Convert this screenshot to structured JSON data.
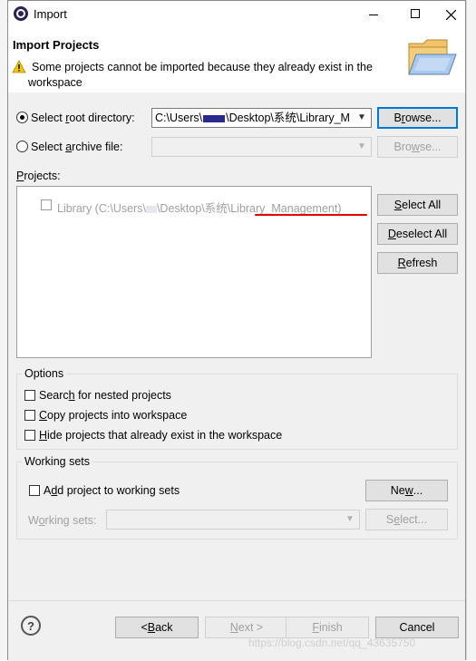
{
  "window": {
    "title": "Import"
  },
  "banner": {
    "title": "Import Projects",
    "message_line1": "Some projects cannot be imported because they already exist in the",
    "message_line2": "workspace"
  },
  "source": {
    "root_label_pre": "Select ",
    "root_label_u": "r",
    "root_label_post": "oot directory:",
    "root_value_pre": "C:\\Users\\",
    "root_value_post": "\\Desktop\\系统\\Library_M",
    "root_browse_pre": "B",
    "root_browse_u": "r",
    "root_browse_post": "owse...",
    "archive_label_pre": "Select ",
    "archive_label_u": "a",
    "archive_label_post": "rchive file:",
    "archive_value": "",
    "archive_browse_pre": "Bro",
    "archive_browse_u": "w",
    "archive_browse_post": "se..."
  },
  "projects": {
    "label_u": "P",
    "label_post": "rojects:",
    "items": [
      {
        "text_pre": "Library (C:\\Users\\",
        "text_post": "\\Desktop\\系统\\",
        "text_mark": "Library_Management)",
        "checked": false
      }
    ],
    "select_all_u": "S",
    "select_all_post": "elect All",
    "deselect_all_u": "D",
    "deselect_all_post": "eselect All",
    "refresh_pre": "R",
    "refresh_post": "efresh"
  },
  "options": {
    "title": "Options",
    "nested_pre": "Searc",
    "nested_u": "h",
    "nested_post": " for nested projects",
    "copy_u": "C",
    "copy_post": "opy projects into workspace",
    "hide_u": "H",
    "hide_post": "ide projects that already exist in the workspace"
  },
  "working_sets": {
    "title": "Working sets",
    "add_pre": "A",
    "add_u": "d",
    "add_post": "d project to working sets",
    "new_pre": "Ne",
    "new_u": "w",
    "new_post": "...",
    "sets_pre": "W",
    "sets_u": "o",
    "sets_post": "rking sets:",
    "select_pre": "S",
    "select_u": "e",
    "select_post": "lect..."
  },
  "footer": {
    "back_pre": "< ",
    "back_u": "B",
    "back_post": "ack",
    "next_u": "N",
    "next_post": "ext >",
    "finish_u": "F",
    "finish_post": "inish",
    "cancel": "Cancel",
    "watermark": "https://blog.csdn.net/qq_43635750"
  },
  "colors": {
    "focus": "#0078d7",
    "warning": "#f5c400",
    "underline_mark": "#e00000"
  }
}
